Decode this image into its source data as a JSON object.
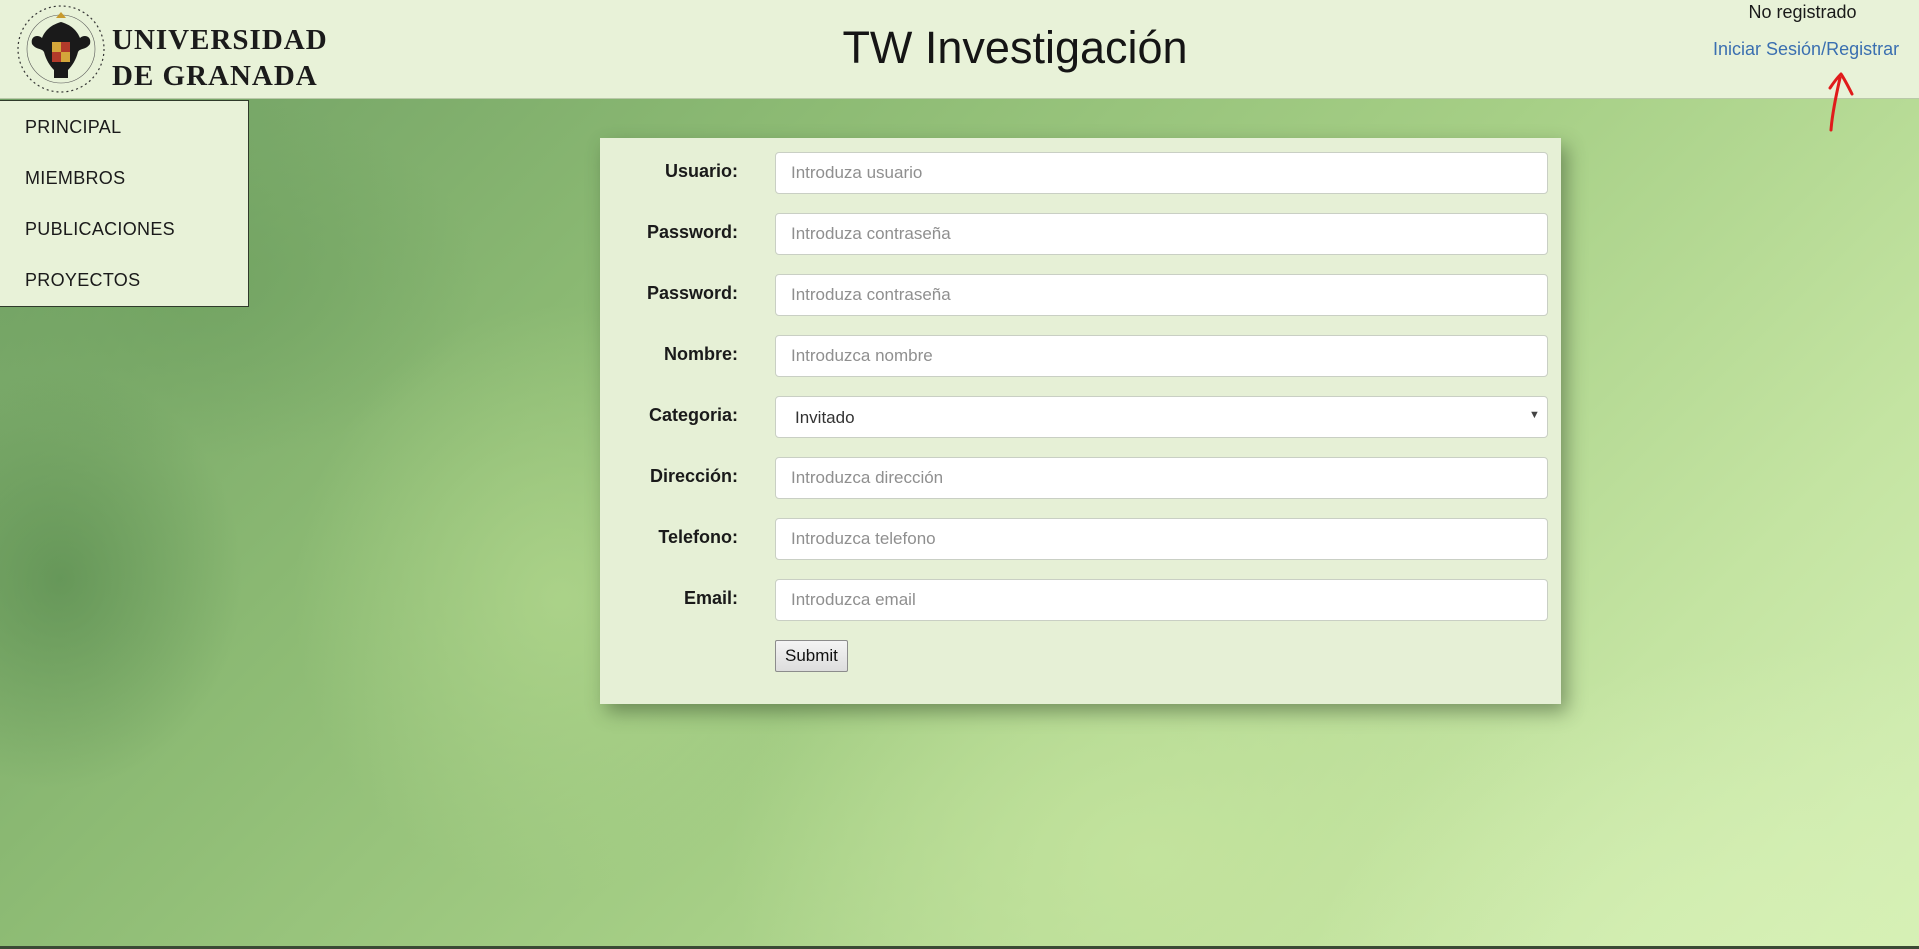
{
  "header": {
    "logo": {
      "line1": "UNIVERSIDAD",
      "line2": "DE GRANADA"
    },
    "title": "TW Investigación",
    "user_status": "No registrado",
    "auth": {
      "login": "Iniciar Sesión",
      "separator": "/",
      "register": "Registrar"
    }
  },
  "sidenav": {
    "items": [
      "PRINCIPAL",
      "MIEMBROS",
      "PUBLICACIONES",
      "PROYECTOS"
    ]
  },
  "form": {
    "fields": [
      {
        "label": "Usuario:",
        "placeholder": "Introduza usuario",
        "type": "text"
      },
      {
        "label": "Password:",
        "placeholder": "Introduza contraseña",
        "type": "password"
      },
      {
        "label": "Password:",
        "placeholder": "Introduza contraseña",
        "type": "password"
      },
      {
        "label": "Nombre:",
        "placeholder": "Introduzca nombre",
        "type": "text"
      },
      {
        "label": "Categoria:",
        "selected": "Invitado",
        "type": "select"
      },
      {
        "label": "Dirección:",
        "placeholder": "Introduzca dirección",
        "type": "text"
      },
      {
        "label": "Telefono:",
        "placeholder": "Introduzca telefono",
        "type": "text"
      },
      {
        "label": "Email:",
        "placeholder": "Introduzca email",
        "type": "email"
      }
    ],
    "submit_label": "Submit"
  },
  "colors": {
    "header_bg": "#e8f2d8",
    "link": "#3a6fb0",
    "annotation": "#e01b1b"
  }
}
